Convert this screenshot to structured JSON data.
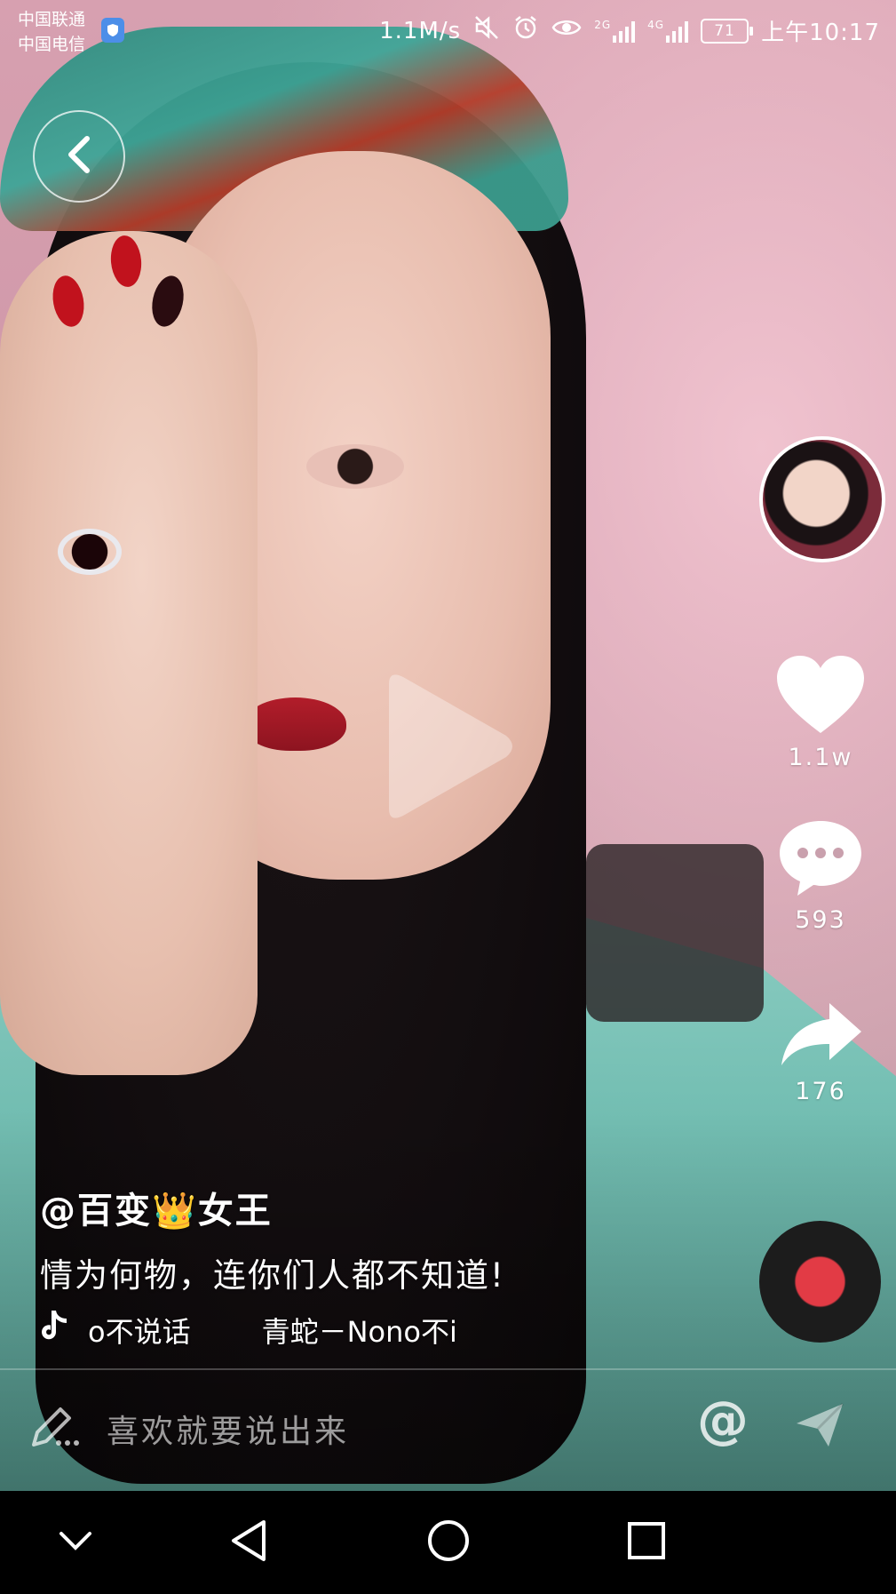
{
  "status_bar": {
    "carrier_1": "中国联通",
    "carrier_2": "中国电信",
    "net_speed": "1.1M/s",
    "network_1": "2G",
    "network_2": "4G",
    "battery": "71",
    "time": "上午10:17"
  },
  "icons": {
    "back": "chevron-left-icon",
    "play": "play-icon",
    "like": "heart-icon",
    "comment": "comment-icon",
    "share": "share-icon",
    "music": "tiktok-note-icon",
    "compose": "pen-icon",
    "at": "at-icon",
    "send": "send-icon"
  },
  "video": {
    "author": "@百变👑女王",
    "description": "情为何物，连你们人都不知道!",
    "music_segment_1": "o不说话",
    "music_segment_2": "青蛇－Nono不i"
  },
  "actions": {
    "likes": "1.1w",
    "comments": "593",
    "shares": "176"
  },
  "comment_bar": {
    "placeholder": "喜欢就要说出来",
    "at_label": "@"
  },
  "colors": {
    "accent_red": "#e23b45",
    "robe_teal": "#6fc0b3",
    "wall_pink": "#d7a0b0"
  }
}
